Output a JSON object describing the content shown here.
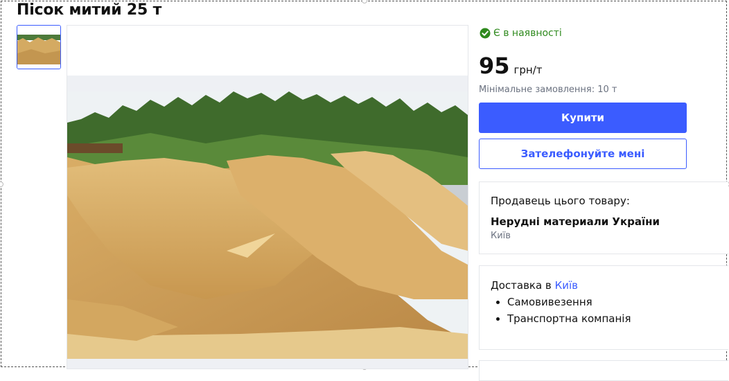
{
  "product": {
    "title": "Пісок митий 25 т"
  },
  "gallery": {
    "thumbnail_icon": "sand-pile-thumbnail",
    "main_image_icon": "sand-pile-photo"
  },
  "availability": {
    "icon": "check-circle-icon",
    "text": "Є в наявності"
  },
  "price": {
    "value": "95",
    "unit": "грн/т",
    "min_order": "Мінімальне замовлення: 10 т"
  },
  "actions": {
    "buy_label": "Купити",
    "call_label": "Зателефонуйте мені"
  },
  "seller": {
    "label": "Продавець цього товару:",
    "name": "Нерудні материали України",
    "city": "Київ"
  },
  "delivery": {
    "label": "Доставка в",
    "city": "Київ",
    "options": [
      "Самовивезення",
      "Транспортна компанія"
    ]
  },
  "colors": {
    "accent": "#3b5cff",
    "in_stock": "#2f8a1e",
    "muted": "#6b7280"
  }
}
